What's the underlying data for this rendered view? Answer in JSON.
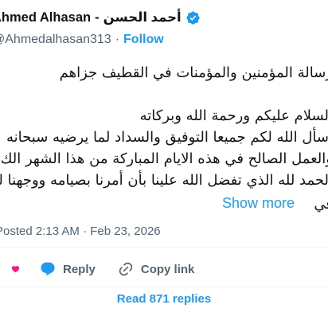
{
  "author": {
    "name": "Ahmed Alhasan",
    "name_arabic": "أحمد الحسن",
    "separator": "-",
    "handle": "@Ahmedalhasan313",
    "follow_label": "Follow"
  },
  "tweet": {
    "lines": [
      "رسالة المؤمنين والمؤمنات في القطيف جزاهم",
      "",
      "السلام عليكم ورحمة الله وبركاته",
      "أسأل الله لكم جميعا التوفيق والسداد لما يرضيه سبحانه",
      "والعمل الصالح في هذه الايام المباركة من هذا الشهر الك",
      "الحمد لله الذي تفضل الله علينا بأن أمرنا بصيامه ووجهنا لع",
      "في"
    ],
    "show_more_label": "Show more"
  },
  "meta": {
    "posted": "Posted 2:13 AM · Feb 23, 2026"
  },
  "actions": {
    "reply_label": "Reply",
    "copy_link_label": "Copy link"
  },
  "footer": {
    "read_replies_label": "Read 871 replies"
  },
  "colors": {
    "accent": "#1d9bf0",
    "like": "#f91880",
    "secondary_text": "#536471",
    "divider": "#eff3f4"
  },
  "icons": [
    "verified-badge-icon",
    "heart-icon",
    "reply-bubble-icon",
    "link-icon"
  ]
}
